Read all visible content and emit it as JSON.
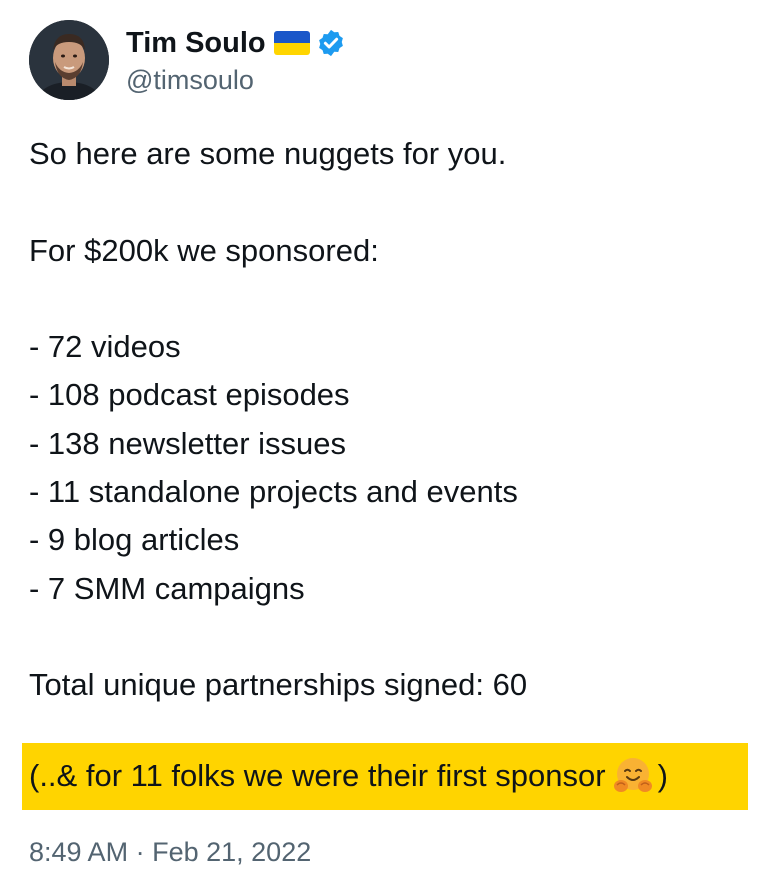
{
  "author": {
    "display_name": "Tim Soulo",
    "handle": "@timsoulo",
    "flag_icon": "ukraine-flag-icon",
    "verified_icon": "verified-badge-icon",
    "verified_color": "#1d9bf0"
  },
  "tweet": {
    "lines": [
      "So here are some nuggets for you.",
      "",
      "For $200k we sponsored:",
      "",
      "- 72 videos",
      "- 108 podcast episodes",
      "- 138 newsletter issues",
      "- 11 standalone projects and events",
      "- 9 blog articles",
      "- 7 SMM campaigns",
      "",
      "Total unique partnerships signed: 60"
    ],
    "highlight": {
      "text": "(..& for 11 folks we were their first sponsor",
      "emoji_icon": "hugging-face-emoji-icon",
      "closing": ")",
      "background": "#ffd400"
    }
  },
  "meta": {
    "time": "8:49 AM",
    "separator": "·",
    "date": "Feb 21, 2022"
  }
}
